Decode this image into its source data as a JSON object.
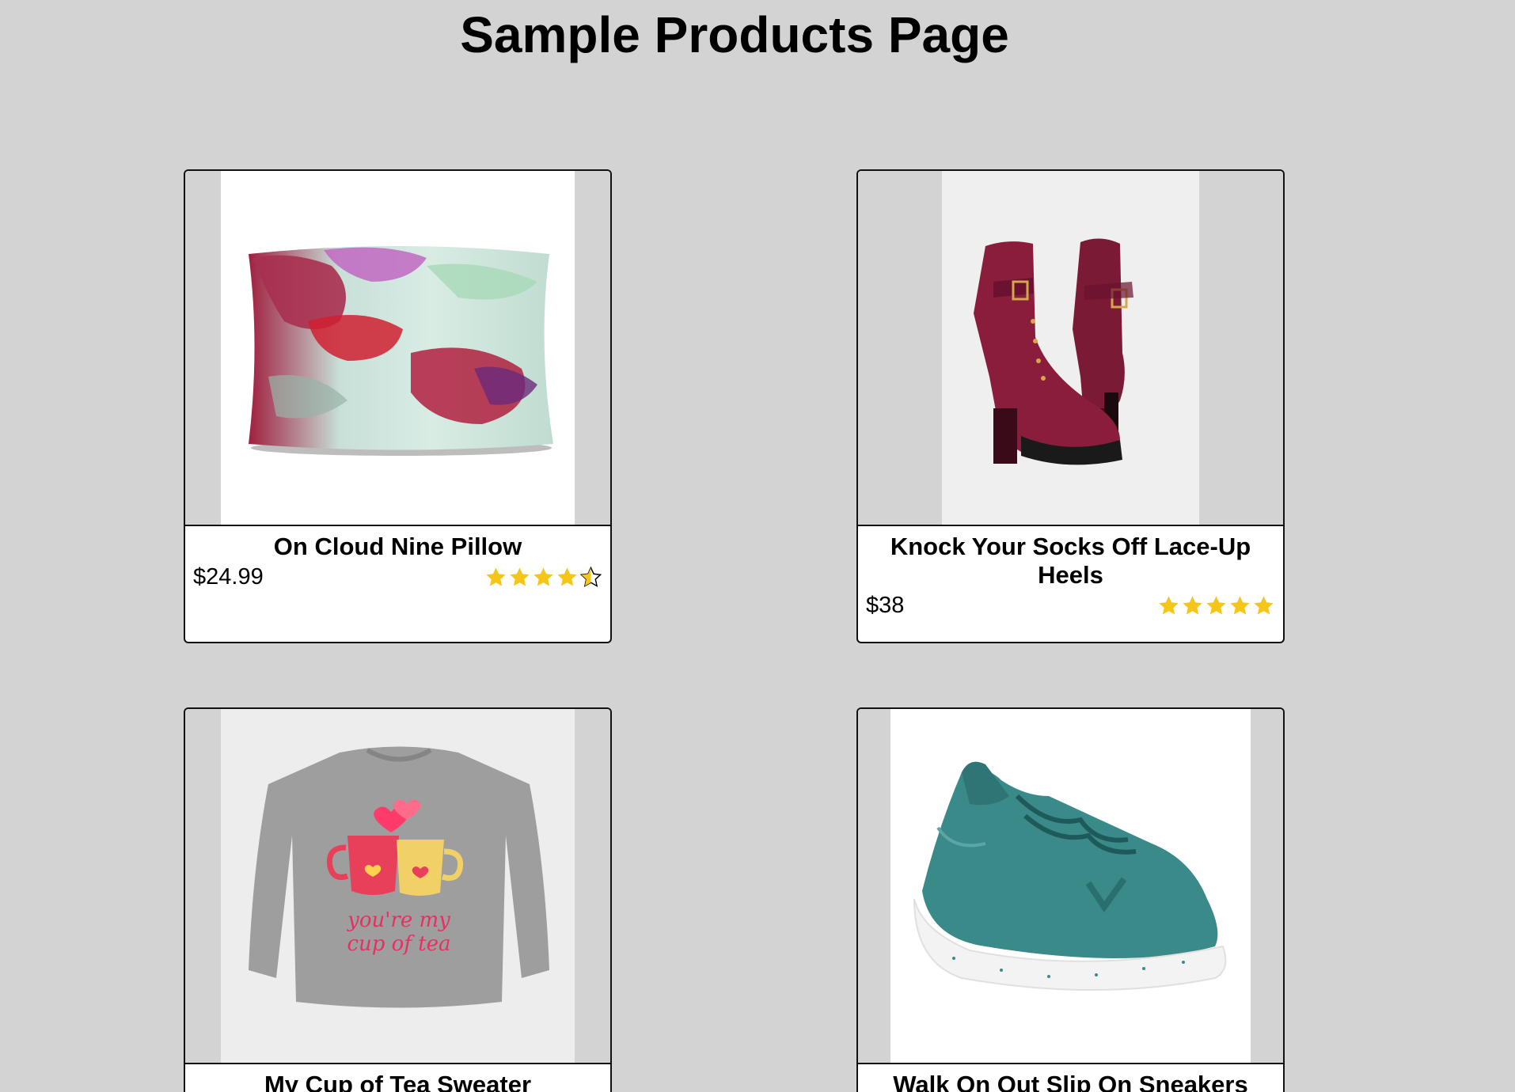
{
  "page": {
    "title": "Sample Products Page"
  },
  "colors": {
    "background": "#d3d3d3",
    "star": "#f5c518"
  },
  "products": [
    {
      "name": "On Cloud Nine Pillow",
      "price": "$24.99",
      "rating": 4.5,
      "image": "pillow-image"
    },
    {
      "name": "Knock Your Socks Off Lace-Up Heels",
      "price": "$38",
      "rating": 5,
      "image": "boots-image"
    },
    {
      "name": "My Cup of Tea Sweater",
      "price": "",
      "rating": null,
      "image": "sweater-image"
    },
    {
      "name": "Walk On Out Slip On Sneakers",
      "price": "",
      "rating": null,
      "image": "sneaker-image"
    }
  ],
  "sweater_print": {
    "line1": "you're my",
    "line2": "cup of tea"
  }
}
